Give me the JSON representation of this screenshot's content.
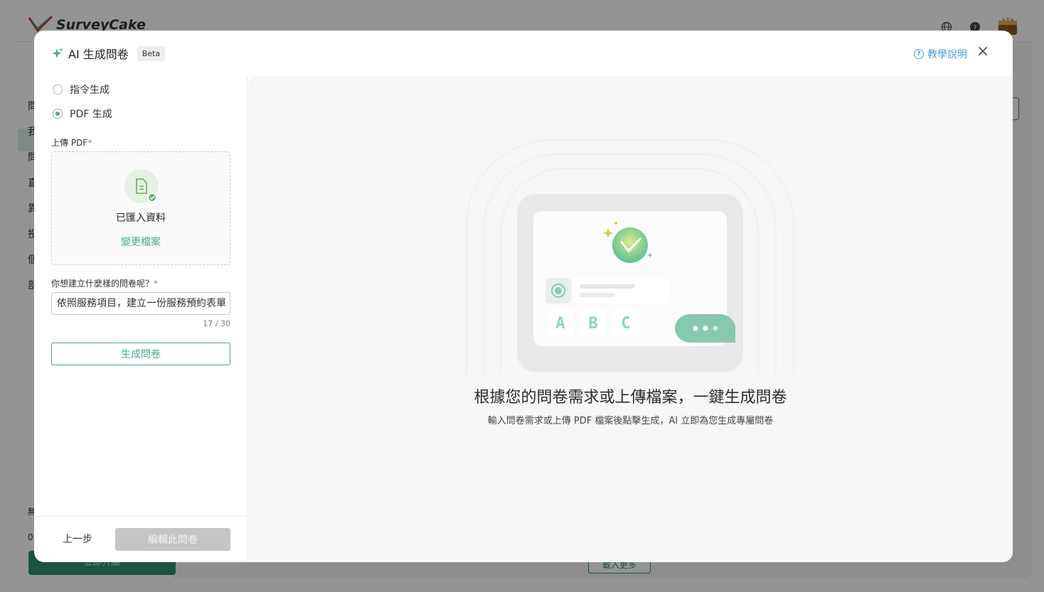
{
  "background_app": {
    "logo_text": "SurveyCake",
    "sidebar_fragments": [
      "問",
      "我",
      "問",
      "直",
      "異",
      "投",
      "個",
      "部"
    ],
    "bottom_fragments": [
      "無",
      "0"
    ],
    "cta_label": "立即升級",
    "loadmore_label": "載入更多"
  },
  "modal": {
    "title": "AI 生成問卷",
    "badge": "Beta",
    "help_label": "教學說明",
    "close_icon": "close-icon",
    "accent_color": "#4aaa86"
  },
  "left": {
    "options": [
      {
        "label": "指令生成",
        "checked": false
      },
      {
        "label": "PDF 生成",
        "checked": true
      }
    ],
    "upload_label": "上傳 PDF",
    "upload_status": "已匯入資料",
    "change_file": "變更檔案",
    "question_label": "你想建立什麼樣的問卷呢？",
    "input_value": "依照服務項目，建立一份服務預約表單",
    "char_count": "17 / 30",
    "generate_button": "生成問卷",
    "back_button": "上一步",
    "edit_button": "編輯此問卷"
  },
  "right": {
    "options": [
      "A",
      "B",
      "C"
    ],
    "title": "根據您的問卷需求或上傳檔案，一鍵生成問卷",
    "subtitle": "輸入問卷需求或上傳 PDF 檔案後點擊生成，AI 立即為您生成專屬問卷"
  }
}
